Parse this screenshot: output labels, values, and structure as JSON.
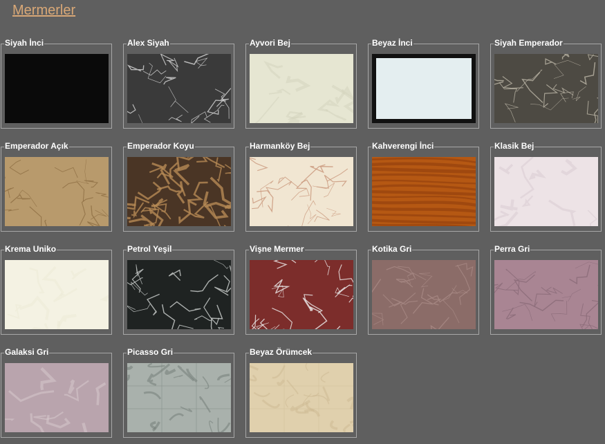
{
  "page": {
    "title": "Mermerler"
  },
  "items": [
    {
      "name": "Siyah İnci",
      "bg": "#0a0a0a",
      "vein": "#1a1a1a",
      "style": "plain"
    },
    {
      "name": "Alex Siyah",
      "bg": "#3a3a3a",
      "vein": "#d8d8d8",
      "style": "lines"
    },
    {
      "name": "Ayvori Bej",
      "bg": "#e6e6d2",
      "vein": "#d2d2bc",
      "style": "soft"
    },
    {
      "name": "Beyaz İnci",
      "bg": "#e4eef0",
      "vein": "#111111",
      "style": "framed"
    },
    {
      "name": "Siyah Emperador",
      "bg": "#4d4a43",
      "vein": "#bdb6a8",
      "style": "veins"
    },
    {
      "name": "Emperador Açık",
      "bg": "#b89a6c",
      "vein": "#8d6e44",
      "style": "veins"
    },
    {
      "name": "Emperador Koyu",
      "bg": "#4a3525",
      "vein": "#b58a55",
      "style": "dark"
    },
    {
      "name": "Harmanköy Bej",
      "bg": "#f1e6d2",
      "vein": "#c9977c",
      "style": "cracks"
    },
    {
      "name": "Kahverengi İnci",
      "bg": "#b55813",
      "vein": "#8c3d0c",
      "style": "wood"
    },
    {
      "name": "Klasik Bej",
      "bg": "#ede3e6",
      "vein": "#d8cad0",
      "style": "soft"
    },
    {
      "name": "Krema Uniko",
      "bg": "#f4f2e3",
      "vein": "#ece9d6",
      "style": "soft"
    },
    {
      "name": "Petrol Yeşil",
      "bg": "#1f2322",
      "vein": "#cfd3d2",
      "style": "lines"
    },
    {
      "name": "Vişne Mermer",
      "bg": "#7c2d2b",
      "vein": "#eeeeee",
      "style": "cracks"
    },
    {
      "name": "Kotika Gri",
      "bg": "#8b6c68",
      "vein": "#a88a84",
      "style": "veins"
    },
    {
      "name": "Perra Gri",
      "bg": "#a98593",
      "vein": "#8a6a78",
      "style": "veins"
    },
    {
      "name": "Galaksi Gri",
      "bg": "#b9a4ad",
      "vein": "#d9cbd0",
      "style": "soft"
    },
    {
      "name": "Picasso Gri",
      "bg": "#a9b1ac",
      "vein": "#6f7a74",
      "style": "tiles"
    },
    {
      "name": "Beyaz Örümcek",
      "bg": "#e0d0ad",
      "vein": "#cbb892",
      "style": "tiles"
    }
  ]
}
